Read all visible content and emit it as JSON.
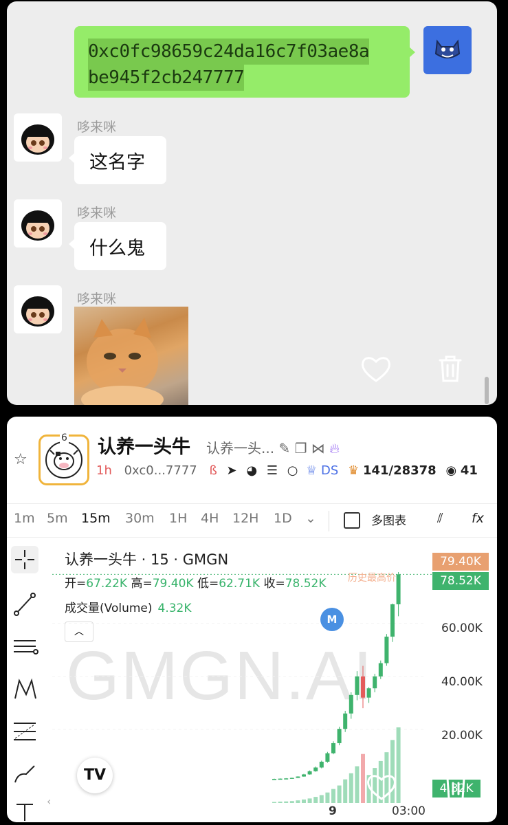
{
  "chat": {
    "my_message": "0xc0fc98659c24da16c7f03ae8a be945f2cb247777",
    "my_message_lines": [
      "0xc0fc98659c24da16c7f03ae8a",
      "be945f2cb247777"
    ],
    "messages": [
      {
        "sender": "哆来咪",
        "text": "这名字"
      },
      {
        "sender": "哆来咪",
        "text": "什么鬼"
      },
      {
        "sender": "哆来咪",
        "text": ""
      }
    ],
    "icons": [
      "heart-icon",
      "trash-icon"
    ]
  },
  "token": {
    "name": "认养一头牛",
    "name_truncated": "认养一头...",
    "badge_count": "6",
    "age": "1h",
    "address_short": "0xc0...7777",
    "ds_label": "DS",
    "holders": "141/28378",
    "views_prefix": "41"
  },
  "timeframes": [
    "1m",
    "5m",
    "15m",
    "30m",
    "1H",
    "4H",
    "12H",
    "1D"
  ],
  "active_timeframe": "15m",
  "multi_chart_label": "多图表",
  "chart": {
    "symbol": "认养一头牛 · 15 · GMGN",
    "open_label": "开=",
    "open": "67.22K",
    "high_label": "高=",
    "high": "79.40K",
    "low_label": "低=",
    "low": "62.71K",
    "close_label": "收=",
    "close": "78.52K",
    "volume_label": "成交量(Volume)",
    "volume": "4.32K",
    "watermark": "GMGN.AI",
    "ath_label": "历史最高价",
    "price_tag_high": "79.40K",
    "price_tag_last": "78.52K",
    "volume_tag": "4.32K",
    "y_labels": [
      "60.00K",
      "40.00K",
      "20.00K"
    ],
    "x_labels": [
      "9",
      "03:00"
    ],
    "marker": "M"
  },
  "chart_data": {
    "type": "candlestick",
    "title": "认养一头牛 · 15 · GMGN",
    "ylim": [
      0,
      82000
    ],
    "y_ticks": [
      20000,
      40000,
      60000
    ],
    "series": [
      {
        "ohlc": [
          [
            1200,
            1400,
            1100,
            1300
          ],
          [
            1300,
            1500,
            1200,
            1400
          ],
          [
            1400,
            1600,
            1300,
            1500
          ],
          [
            1500,
            1800,
            1400,
            1700
          ],
          [
            1700,
            2300,
            1600,
            2200
          ],
          [
            2200,
            3200,
            2100,
            3000
          ],
          [
            3000,
            4500,
            2900,
            4200
          ],
          [
            4200,
            6000,
            4000,
            5600
          ],
          [
            5600,
            8200,
            5300,
            7800
          ],
          [
            7800,
            11500,
            7400,
            11000
          ],
          [
            11000,
            15500,
            10600,
            14800
          ],
          [
            14800,
            21000,
            14000,
            20200
          ],
          [
            20200,
            27000,
            19000,
            26000
          ],
          [
            26000,
            34000,
            24000,
            33000
          ],
          [
            33000,
            42000,
            31000,
            40000
          ],
          [
            40000,
            44000,
            28000,
            32000
          ],
          [
            32000,
            36000,
            30000,
            35500
          ],
          [
            35500,
            41000,
            34000,
            40000
          ],
          [
            40000,
            46000,
            39000,
            45000
          ],
          [
            45000,
            56000,
            44000,
            55000
          ],
          [
            55000,
            67500,
            53000,
            67220
          ],
          [
            67220,
            79400,
            62710,
            78520
          ]
        ],
        "volume": [
          60,
          80,
          90,
          110,
          150,
          200,
          260,
          350,
          450,
          600,
          800,
          1000,
          1350,
          1700,
          2100,
          2800,
          1600,
          2000,
          2400,
          2900,
          3600,
          4320
        ]
      }
    ]
  }
}
